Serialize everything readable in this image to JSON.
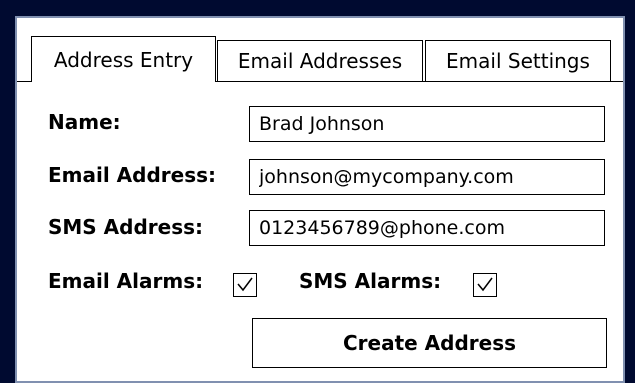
{
  "tabs": [
    {
      "label": "Address Entry",
      "active": true
    },
    {
      "label": "Email Addresses",
      "active": false
    },
    {
      "label": "Email Settings",
      "active": false
    }
  ],
  "form": {
    "name_label": "Name:",
    "name_value": "Brad Johnson",
    "email_label": "Email Address:",
    "email_value": "johnson@mycompany.com",
    "sms_label": "SMS Address:",
    "sms_value": "0123456789@phone.com",
    "email_alarms_label": "Email Alarms:",
    "email_alarms_checked": true,
    "sms_alarms_label": "SMS Alarms:",
    "sms_alarms_checked": true
  },
  "actions": {
    "create_label": "Create Address"
  },
  "colors": {
    "background": "#000a30",
    "panel": "#ffffff",
    "border": "#000000"
  }
}
